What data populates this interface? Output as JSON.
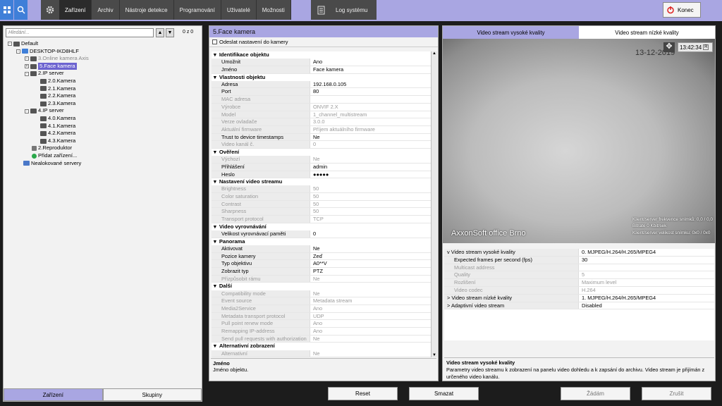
{
  "topbar": {
    "tabs": [
      "Zařízení",
      "Archiv",
      "Nástroje detekce",
      "Programování",
      "Uživatelé",
      "Možnosti"
    ],
    "log_tab": "Log systému",
    "exit_label": "Konec"
  },
  "left": {
    "search_placeholder": "Hledání...",
    "count": "0 z 0",
    "tree": [
      {
        "label": "Default",
        "indent": 0,
        "icon": "server-icon",
        "expand": "-"
      },
      {
        "label": "DESKTOP-IKD8HLF",
        "indent": 1,
        "icon": "computer-icon",
        "expand": "-"
      },
      {
        "label": "3.Online kamera Axis",
        "indent": 2,
        "icon": "camera-icon",
        "dim": true,
        "expand": "+"
      },
      {
        "label": "5.Face kamera",
        "indent": 2,
        "icon": "camera-icon",
        "selected": true,
        "expand": "+"
      },
      {
        "label": "2.IP server",
        "indent": 2,
        "icon": "ip-server-icon",
        "expand": "-"
      },
      {
        "label": "2.0.Kamera",
        "indent": 3,
        "icon": "camera-icon"
      },
      {
        "label": "2.1.Kamera",
        "indent": 3,
        "icon": "camera-icon"
      },
      {
        "label": "2.2.Kamera",
        "indent": 3,
        "icon": "camera-icon"
      },
      {
        "label": "2.3.Kamera",
        "indent": 3,
        "icon": "camera-icon"
      },
      {
        "label": "4.IP server",
        "indent": 2,
        "icon": "ip-server-icon",
        "expand": "-"
      },
      {
        "label": "4.0.Kamera",
        "indent": 3,
        "icon": "camera-icon"
      },
      {
        "label": "4.1.Kamera",
        "indent": 3,
        "icon": "camera-icon"
      },
      {
        "label": "4.2.Kamera",
        "indent": 3,
        "icon": "camera-icon"
      },
      {
        "label": "4.3.Kamera",
        "indent": 3,
        "icon": "camera-icon"
      },
      {
        "label": "2.Reproduktor",
        "indent": 2,
        "icon": "speaker-icon"
      },
      {
        "label": "Přidat zařízení...",
        "indent": 2,
        "icon": "search-add-icon"
      },
      {
        "label": "Nealokované servery",
        "indent": 1,
        "icon": "monitor-icon"
      }
    ],
    "bottom_tabs": [
      "Zařízení",
      "Skupiny"
    ]
  },
  "middle": {
    "title": "5.Face kamera",
    "send_settings": "Odeslat nastavení do kamery",
    "sections": [
      {
        "title": "Identifikace objektu",
        "rows": [
          [
            "Umožnit",
            "Ano",
            false
          ],
          [
            "Jméno",
            "Face kamera",
            false
          ]
        ]
      },
      {
        "title": "Vlastnosti objektu",
        "rows": [
          [
            "Adresa",
            "192.168.0.105",
            false
          ],
          [
            "Port",
            "80",
            false
          ],
          [
            "MAC adresa",
            "",
            true
          ],
          [
            "Výrobce",
            "ONVIF 2.X",
            true
          ],
          [
            "Model",
            "1_channel_multistream",
            true
          ],
          [
            "Verze ovladače",
            "3.0.0",
            true
          ],
          [
            "Aktuální firmware",
            "Příjem aktuálního firmware",
            true
          ],
          [
            "Trust to device timestamps",
            "Ne",
            false
          ],
          [
            "Video kanál č.",
            "0",
            true
          ]
        ]
      },
      {
        "title": "Ověření",
        "rows": [
          [
            "Výchozí",
            "Ne",
            true
          ],
          [
            "Přihlášení",
            "admin",
            false
          ],
          [
            "Heslo",
            "●●●●●",
            false
          ]
        ]
      },
      {
        "title": "Nastavení video streamu",
        "rows": [
          [
            "Brightness",
            "50",
            true
          ],
          [
            "Color saturation",
            "50",
            true
          ],
          [
            "Contrast",
            "50",
            true
          ],
          [
            "Sharpness",
            "50",
            true
          ],
          [
            "Transport protocol",
            "TCP",
            true
          ]
        ]
      },
      {
        "title": "Video vyrovnávání",
        "rows": [
          [
            "Velikost vyrovnávací paměti",
            "0",
            false
          ]
        ]
      },
      {
        "title": "Panorama",
        "rows": [
          [
            "Aktivovat",
            "Ne",
            false
          ],
          [
            "Pozice kamery",
            "Zeď",
            false
          ],
          [
            "Typ objektivu",
            "A0**V",
            false
          ],
          [
            "Zobrazit typ",
            "PTZ",
            false
          ],
          [
            "Přizpůsobit rámu",
            "Ne",
            true
          ]
        ]
      },
      {
        "title": "Další",
        "rows": [
          [
            "Compatibility mode",
            "Ne",
            true
          ],
          [
            "Event source",
            "Metadata stream",
            true
          ],
          [
            "Media2Service",
            "Ano",
            true
          ],
          [
            "Metadata transport protocol",
            "UDP",
            true
          ],
          [
            "Pull point renew mode",
            "Ano",
            true
          ],
          [
            "Remapping IP-address",
            "Ano",
            true
          ],
          [
            "Send pull requests with authorization",
            "Ne",
            true
          ]
        ]
      },
      {
        "title": "Alternativní zobrazení",
        "rows": [
          [
            "Alternativní",
            "Ne",
            true
          ]
        ]
      }
    ],
    "desc_title": "Jméno",
    "desc_text": "Jméno objektu."
  },
  "right": {
    "stream_tabs": [
      "Video stream vysoké kvality",
      "Video stream nízké kvality"
    ],
    "video": {
      "date": "13-12-2019",
      "time": "13:42:34",
      "watermark": "AxxonSoft office Brno",
      "stats": [
        "Klient/server frekvence snímků: 0,0 / 0,0",
        "Bitrate 0 Kbit/sek",
        "Klient/server velikost snímku: 0x0 / 0x0"
      ]
    },
    "stream_props": [
      {
        "k": "Video stream vysoké kvality",
        "v": "0. MJPEG/H.264/H.265/MPEG4",
        "top": true,
        "expand": "v"
      },
      {
        "k": "Expected frames per second (fps)",
        "v": "30"
      },
      {
        "k": "Multicast address",
        "v": "",
        "dim": true
      },
      {
        "k": "Quality",
        "v": "5",
        "dim": true
      },
      {
        "k": "Rozlišení",
        "v": "Maximum level",
        "dim": true
      },
      {
        "k": "Video codec",
        "v": "H.264",
        "dim": true
      },
      {
        "k": "Video stream nízké kvality",
        "v": "1. MJPEG/H.264/H.265/MPEG4",
        "top": true,
        "expand": ">"
      },
      {
        "k": "Adaptivní video stream",
        "v": "Disabled",
        "top": true,
        "expand": ">"
      }
    ],
    "desc_title": "Video stream vysoké kvality",
    "desc_text": "Parametry video streamu k zobrazení na panelu video dohledu a k zapsání do archivu. Video stream je přijímán z určeného video kanálu."
  },
  "buttons": {
    "reset": "Reset",
    "delete": "Smazat",
    "apply": "Žádám",
    "cancel": "Zrušit"
  }
}
